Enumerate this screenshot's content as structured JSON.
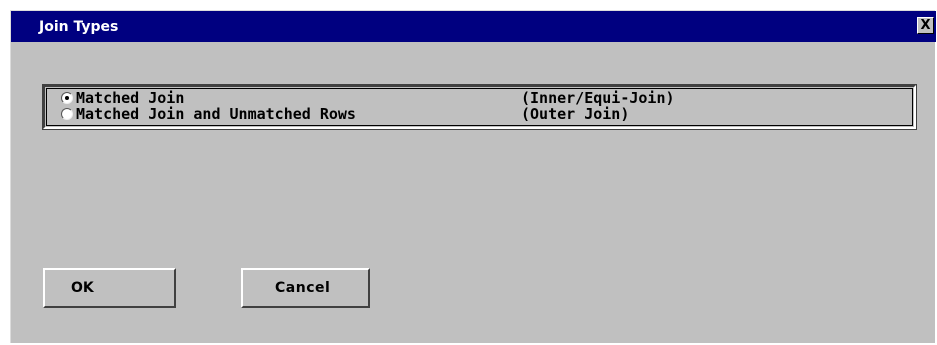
{
  "window": {
    "title": "Join Types",
    "close_label": "X"
  },
  "options": [
    {
      "label": "Matched Join",
      "description": "(Inner/Equi-Join)",
      "selected": true
    },
    {
      "label": "Matched Join and Unmatched Rows",
      "description": "(Outer Join)",
      "selected": false
    }
  ],
  "buttons": {
    "ok": "OK",
    "cancel": "Cancel"
  },
  "colors": {
    "titlebar": "#000080",
    "dialog_bg": "#c0c0c0"
  }
}
